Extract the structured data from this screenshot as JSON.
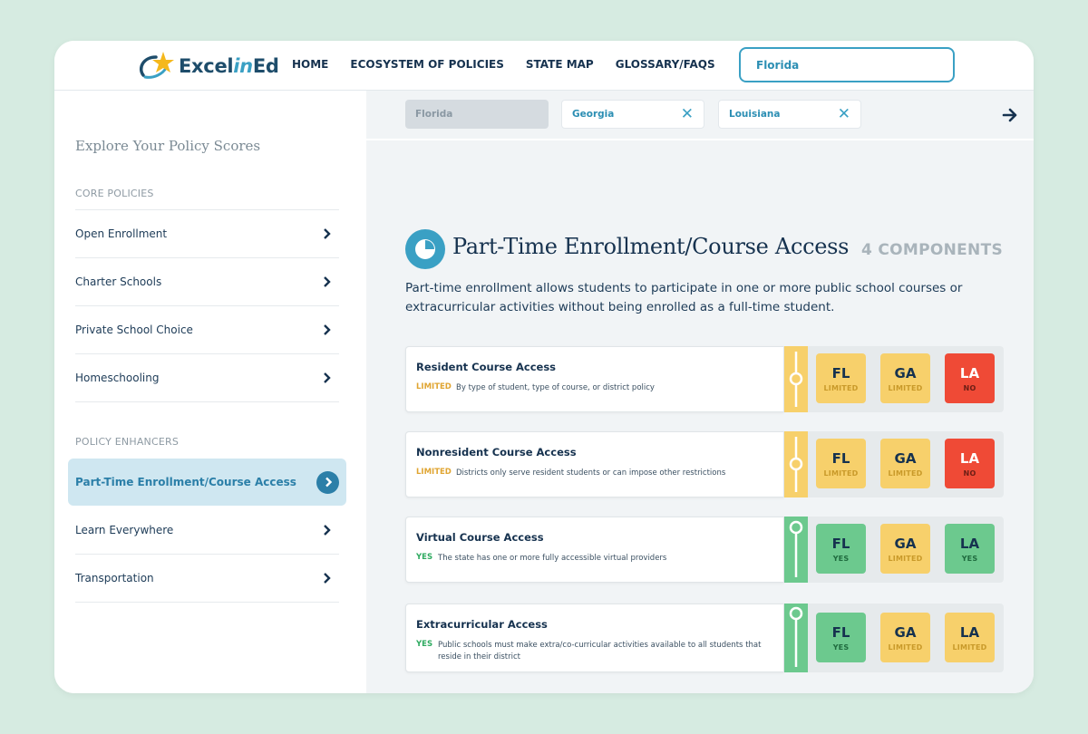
{
  "brand": {
    "logo_excel": "Excel",
    "logo_in": "in",
    "logo_ed": "Ed"
  },
  "nav": {
    "items": [
      "HOME",
      "ECOSYSTEM OF POLICIES",
      "STATE MAP",
      "GLOSSARY/FAQS"
    ]
  },
  "search": {
    "value": "Florida"
  },
  "sidebar": {
    "title": "Explore Your Policy Scores",
    "core_heading": "CORE POLICIES",
    "core_items": [
      "Open Enrollment",
      "Charter Schools",
      "Private School Choice",
      "Homeschooling"
    ],
    "enhancer_heading": "POLICY ENHANCERS",
    "enhancer_items": [
      "Part-Time Enrollment/Course Access",
      "Learn Everywhere",
      "Transportation"
    ],
    "active_item": "Part-Time Enrollment/Course Access"
  },
  "compare": {
    "chips": [
      {
        "label": "Florida",
        "removable": false
      },
      {
        "label": "Georgia",
        "removable": true
      },
      {
        "label": "Louisiana",
        "removable": true
      }
    ],
    "remove_glyph": "✕"
  },
  "policy": {
    "title": "Part-Time Enrollment/Course Access",
    "components_label": "4 COMPONENTS",
    "description": "Part-time enrollment allows students to participate in one or more public school courses or extracurricular activities without being enrolled as a full-time student."
  },
  "components": [
    {
      "name": "Resident Course Access",
      "status": "LIMITED",
      "note": "By type of student, type of course, or district policy",
      "track": "limited",
      "grades": [
        {
          "state": "FL",
          "level": "LIMITED",
          "tone": "yellow"
        },
        {
          "state": "GA",
          "level": "LIMITED",
          "tone": "yellow"
        },
        {
          "state": "LA",
          "level": "NO",
          "tone": "red"
        }
      ]
    },
    {
      "name": "Nonresident Course Access",
      "status": "LIMITED",
      "note": "Districts only serve resident students or can impose other restrictions",
      "track": "limited",
      "grades": [
        {
          "state": "FL",
          "level": "LIMITED",
          "tone": "yellow"
        },
        {
          "state": "GA",
          "level": "LIMITED",
          "tone": "yellow"
        },
        {
          "state": "LA",
          "level": "NO",
          "tone": "red"
        }
      ]
    },
    {
      "name": "Virtual Course Access",
      "status": "YES",
      "note": "The state has one or more fully accessible virtual providers",
      "track": "yes",
      "grades": [
        {
          "state": "FL",
          "level": "YES",
          "tone": "green"
        },
        {
          "state": "GA",
          "level": "LIMITED",
          "tone": "yellow"
        },
        {
          "state": "LA",
          "level": "YES",
          "tone": "green"
        }
      ]
    },
    {
      "name": "Extracurricular Access",
      "status": "YES",
      "note": "Public schools must make extra/co-curricular activities available to all students that reside in their district",
      "track": "yes",
      "grades": [
        {
          "state": "FL",
          "level": "YES",
          "tone": "green"
        },
        {
          "state": "GA",
          "level": "LIMITED",
          "tone": "yellow"
        },
        {
          "state": "LA",
          "level": "LIMITED",
          "tone": "yellow"
        }
      ]
    }
  ],
  "colors": {
    "accent": "#3aa0c4",
    "navy": "#16324f",
    "limited": "#f7d06b",
    "limited_text": "#e0a532",
    "no": "#ef4a36",
    "yes": "#6cc98e",
    "yes_text": "#2eaa60"
  }
}
